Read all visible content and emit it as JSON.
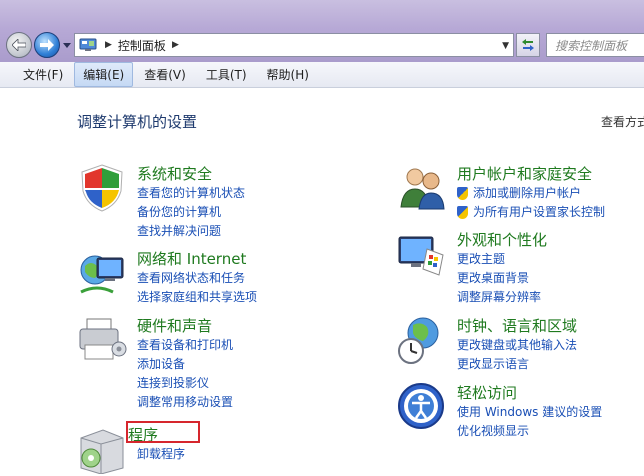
{
  "address": {
    "crumbs": [
      "控制面板"
    ]
  },
  "search": {
    "placeholder": "搜索控制面板"
  },
  "menu": [
    {
      "label": "文件(F)",
      "active": false
    },
    {
      "label": "编辑(E)",
      "active": true
    },
    {
      "label": "查看(V)",
      "active": false
    },
    {
      "label": "工具(T)",
      "active": false
    },
    {
      "label": "帮助(H)",
      "active": false
    }
  ],
  "content": {
    "title": "调整计算机的设置",
    "view_by": "查看方式"
  },
  "categories": {
    "system": {
      "title": "系统和安全",
      "links": [
        "查看您的计算机状态",
        "备份您的计算机",
        "查找并解决问题"
      ]
    },
    "network": {
      "title": "网络和 Internet",
      "links": [
        "查看网络状态和任务",
        "选择家庭组和共享选项"
      ]
    },
    "hardware": {
      "title": "硬件和声音",
      "links": [
        "查看设备和打印机",
        "添加设备",
        "连接到投影仪",
        "调整常用移动设置"
      ]
    },
    "programs": {
      "title": "程序",
      "links": [
        "卸载程序"
      ]
    },
    "users": {
      "title": "用户帐户和家庭安全",
      "links": [
        "添加或删除用户帐户",
        "为所有用户设置家长控制"
      ]
    },
    "appearance": {
      "title": "外观和个性化",
      "links": [
        "更改主题",
        "更改桌面背景",
        "调整屏幕分辨率"
      ]
    },
    "clock": {
      "title": "时钟、语言和区域",
      "links": [
        "更改键盘或其他输入法",
        "更改显示语言"
      ]
    },
    "ease": {
      "title": "轻松访问",
      "links": [
        "使用 Windows 建议的设置",
        "优化视频显示"
      ]
    }
  }
}
